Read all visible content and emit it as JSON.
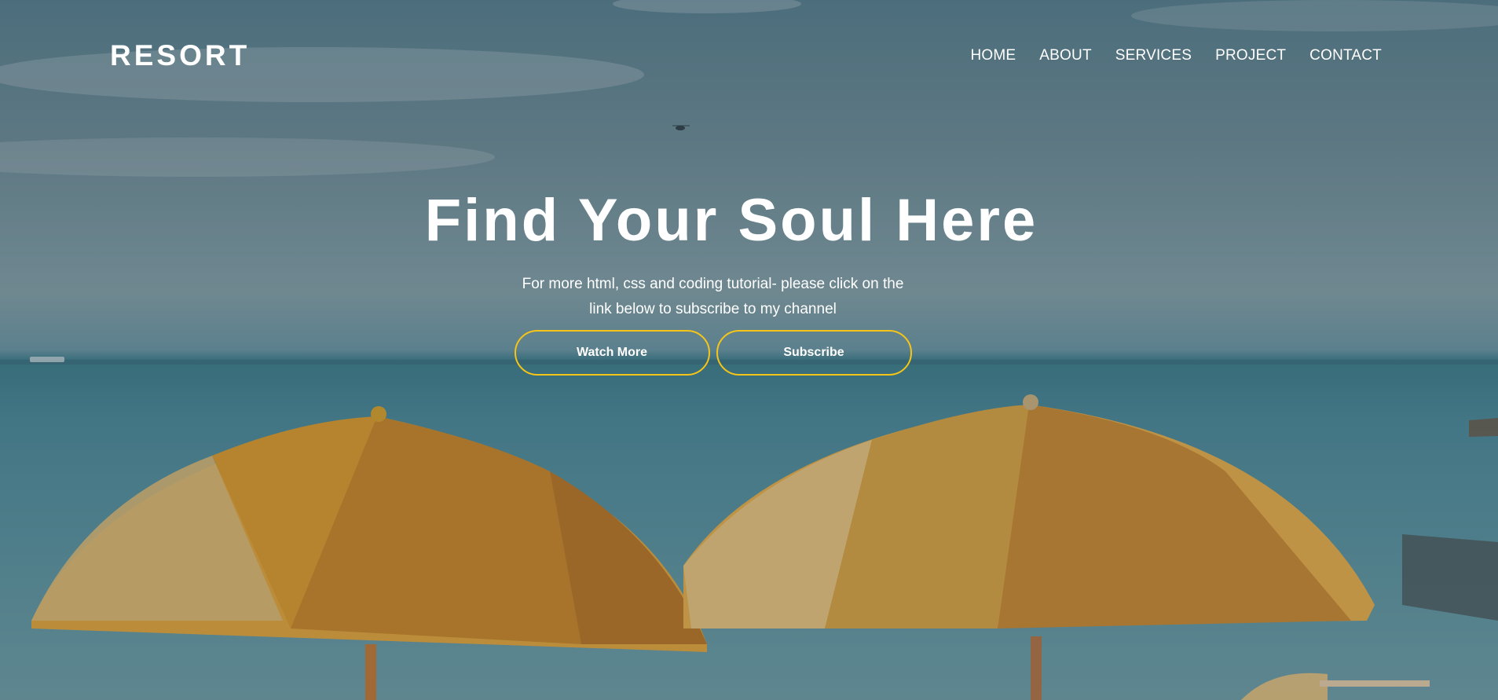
{
  "brand": {
    "logo": "RESORT"
  },
  "nav": {
    "items": [
      {
        "label": "HOME"
      },
      {
        "label": "ABOUT"
      },
      {
        "label": "SERVICES"
      },
      {
        "label": "PROJECT"
      },
      {
        "label": "CONTACT"
      }
    ]
  },
  "hero": {
    "title": "Find Your Soul Here",
    "subtitle": "For more html, css and coding tutorial- please click on the link below to subscribe to my channel",
    "buttons": {
      "watch_more": "Watch More",
      "subscribe": "Subscribe"
    }
  },
  "colors": {
    "button_border": "#f5c518",
    "text": "#ffffff"
  },
  "icons": {
    "background": "beach-umbrellas-image"
  }
}
